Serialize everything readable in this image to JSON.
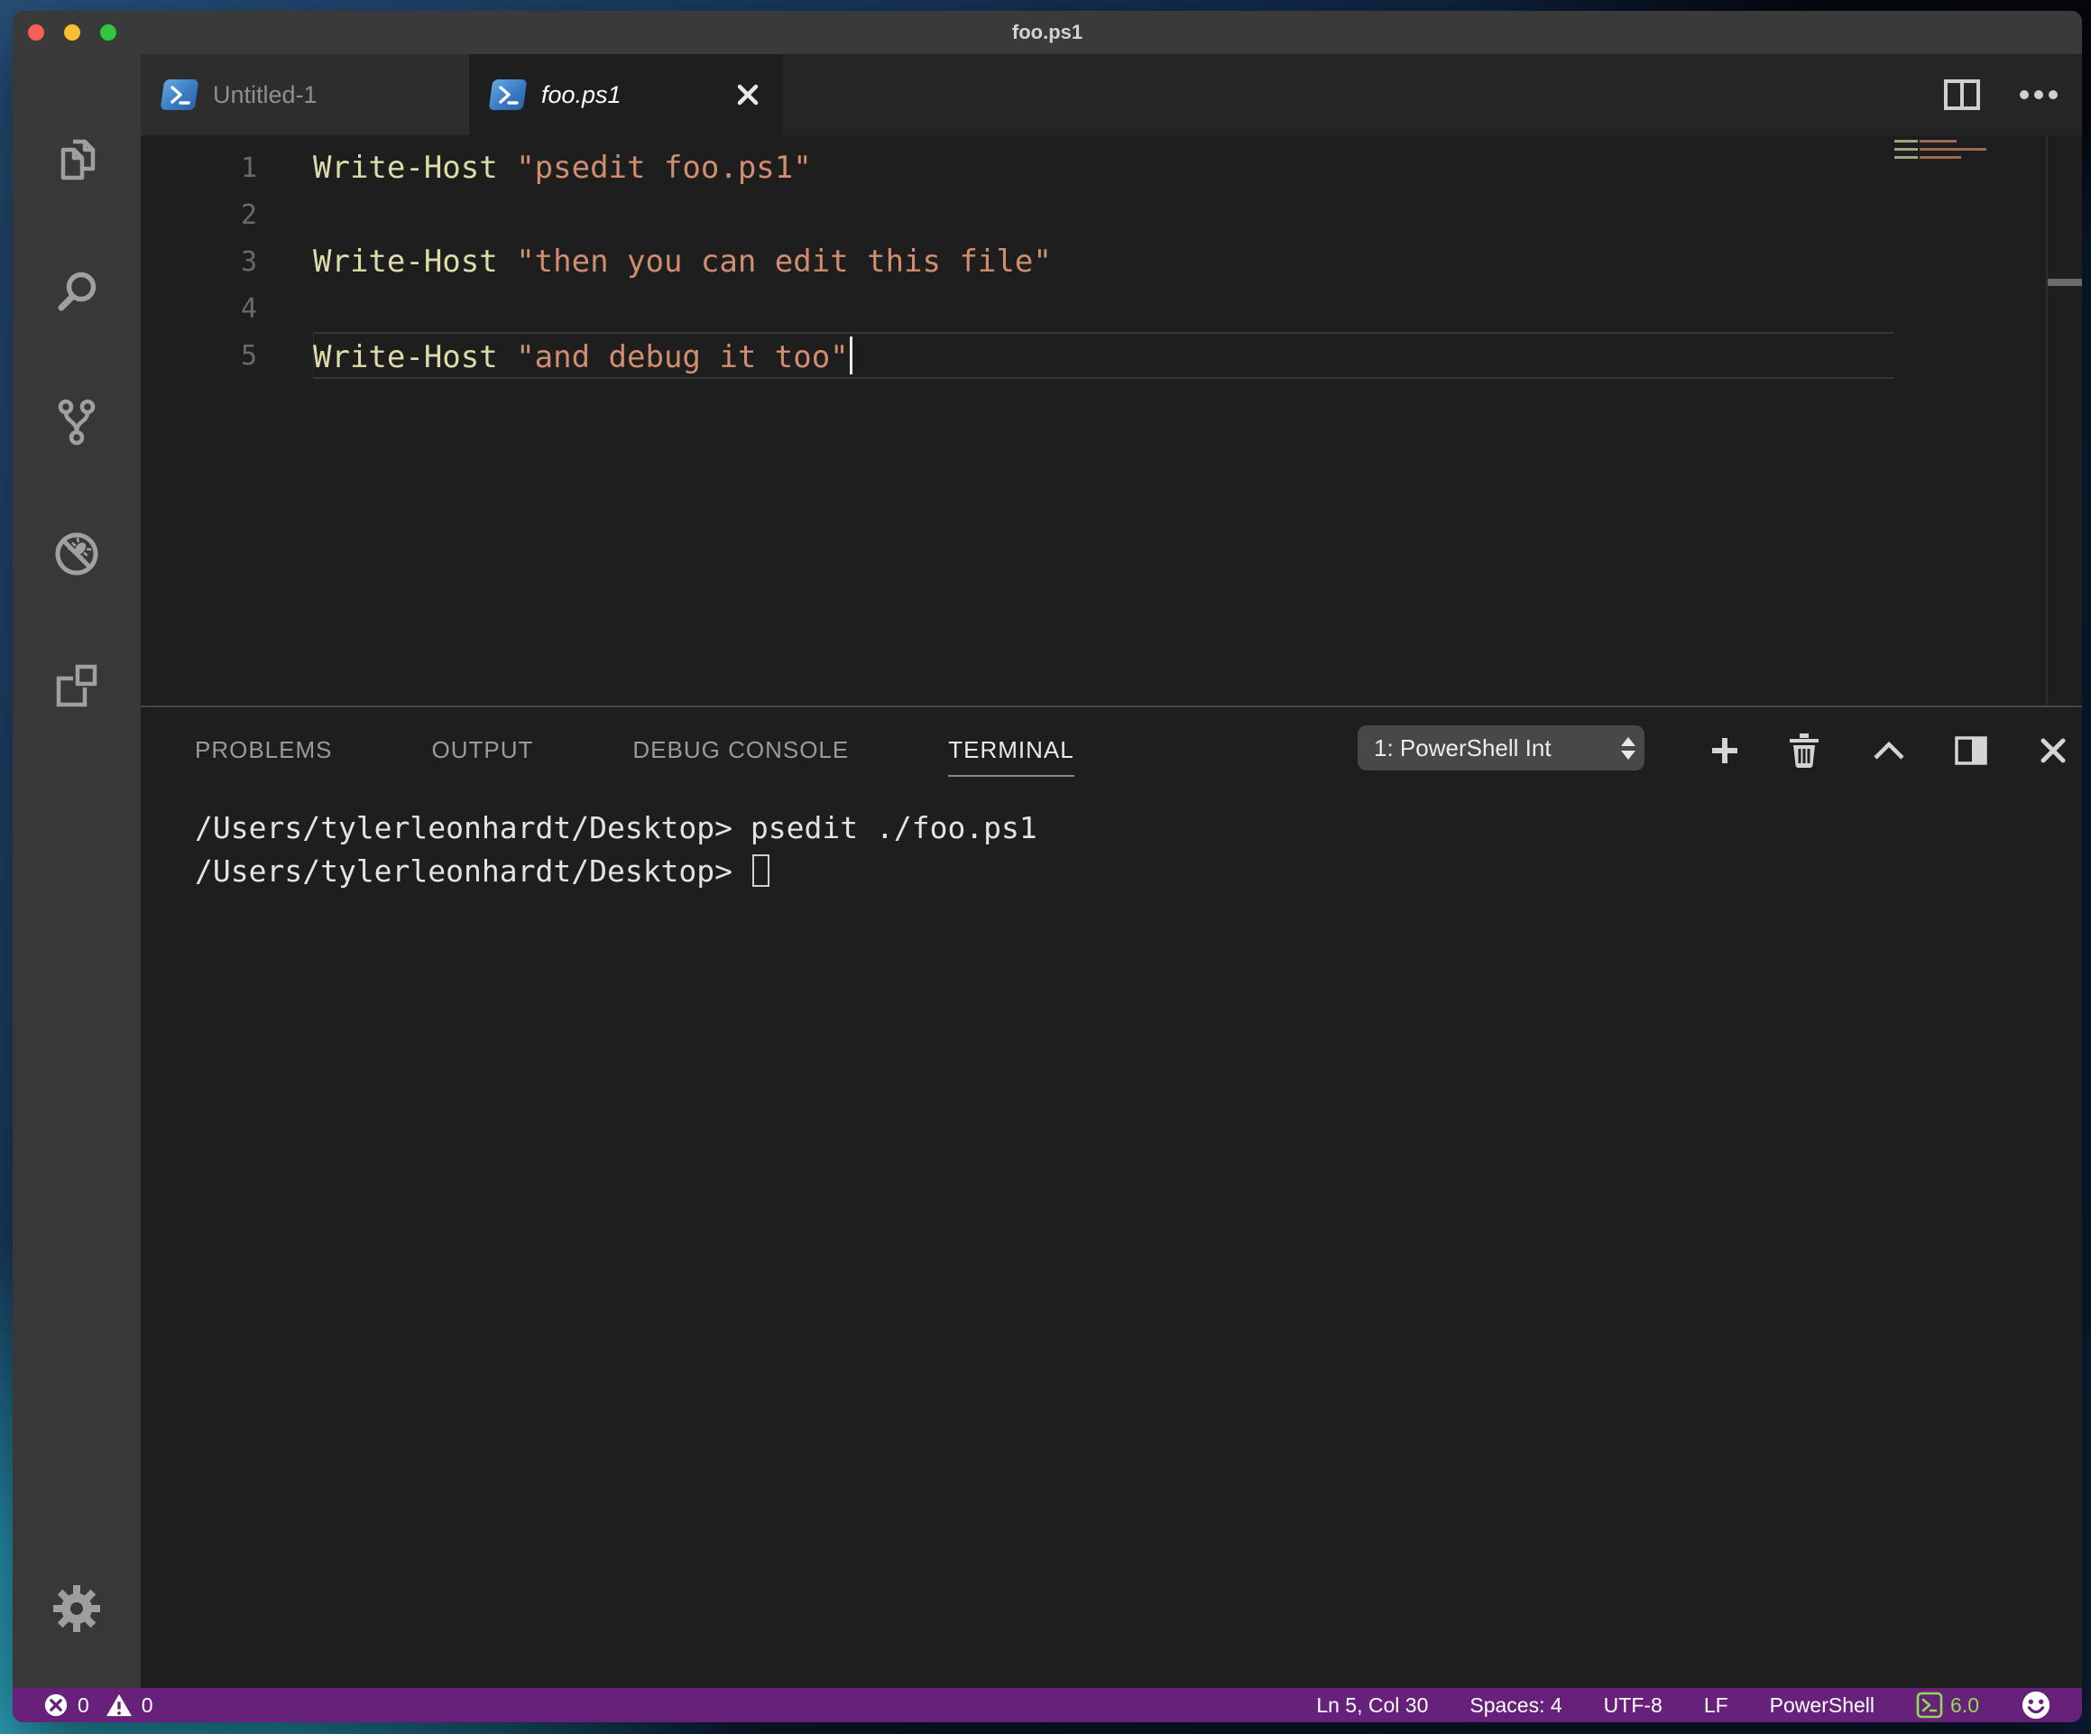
{
  "window": {
    "title": "foo.ps1"
  },
  "colors": {
    "status_bar_bg": "#68217a",
    "powershell_green": "#8fdc4c",
    "cmdlet_color": "#dcdcaa",
    "string_color": "#d18d6f"
  },
  "activity_bar": {
    "items": [
      "explorer",
      "search",
      "source-control",
      "debug",
      "extensions"
    ],
    "bottom": "settings-gear"
  },
  "tab_bar": {
    "tabs": [
      {
        "label": "Untitled-1",
        "icon": "powershell",
        "active": false
      },
      {
        "label": "foo.ps1",
        "icon": "powershell",
        "active": true,
        "preview_italic": true
      }
    ]
  },
  "editor": {
    "lines": [
      {
        "num": "1",
        "tokens": [
          [
            "cmdlet",
            "Write-Host"
          ],
          [
            "plain",
            " "
          ],
          [
            "string",
            "\"psedit foo.ps1\""
          ]
        ]
      },
      {
        "num": "2",
        "tokens": []
      },
      {
        "num": "3",
        "tokens": [
          [
            "cmdlet",
            "Write-Host"
          ],
          [
            "plain",
            " "
          ],
          [
            "string",
            "\"then you can edit this file\""
          ]
        ]
      },
      {
        "num": "4",
        "tokens": []
      },
      {
        "num": "5",
        "tokens": [
          [
            "cmdlet",
            "Write-Host"
          ],
          [
            "plain",
            " "
          ],
          [
            "string",
            "\"and debug it too\""
          ]
        ],
        "current": true,
        "cursor": true
      }
    ]
  },
  "panel": {
    "tabs": [
      {
        "label": "PROBLEMS",
        "active": false
      },
      {
        "label": "OUTPUT",
        "active": false
      },
      {
        "label": "DEBUG CONSOLE",
        "active": false
      },
      {
        "label": "TERMINAL",
        "active": true
      }
    ],
    "terminal_select": {
      "value": "1: PowerShell Int"
    },
    "actions": [
      "new-terminal",
      "kill-terminal",
      "maximize-panel",
      "move-panel",
      "close-panel"
    ],
    "terminal": {
      "lines": [
        {
          "text": "/Users/tylerleonhardt/Desktop> psedit ./foo.ps1"
        },
        {
          "text": "/Users/tylerleonhardt/Desktop> ",
          "cursor": true
        }
      ]
    }
  },
  "status_bar": {
    "errors": "0",
    "warnings": "0",
    "cursor_position": "Ln 5, Col 30",
    "indentation": "Spaces: 4",
    "encoding": "UTF-8",
    "eol": "LF",
    "language": "PowerShell",
    "ps_version": "6.0"
  }
}
